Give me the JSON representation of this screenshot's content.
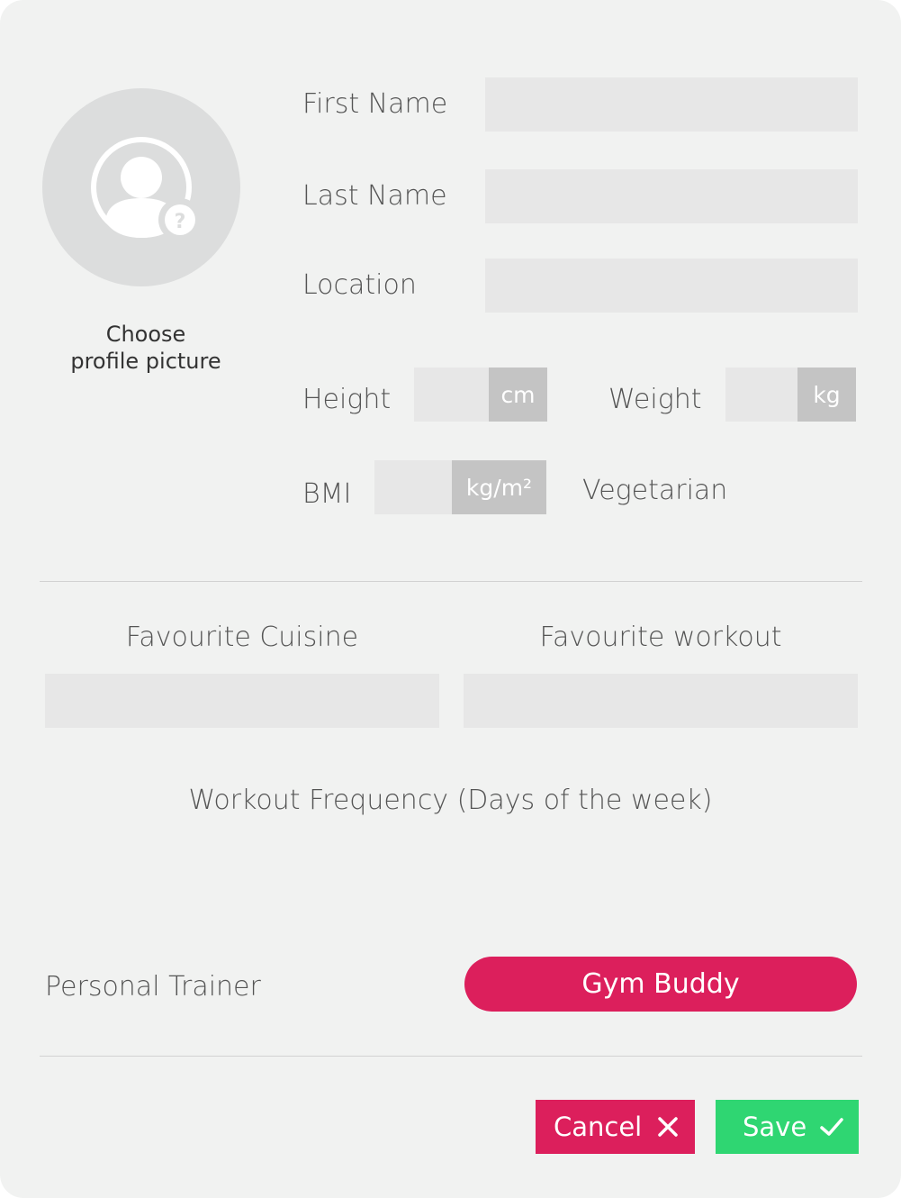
{
  "profile": {
    "choose_line1": "Choose",
    "choose_line2": "profile picture",
    "avatar_icon": "user-question-icon"
  },
  "fields": {
    "first_name": {
      "label": "First Name",
      "value": ""
    },
    "last_name": {
      "label": "Last Name",
      "value": ""
    },
    "location": {
      "label": "Location",
      "value": ""
    },
    "height": {
      "label": "Height",
      "unit": "cm",
      "value": ""
    },
    "weight": {
      "label": "Weight",
      "unit": "kg",
      "value": ""
    },
    "bmi": {
      "label": "BMI",
      "unit": "kg/m²",
      "value": ""
    },
    "vegetarian": {
      "label": "Vegetarian"
    }
  },
  "favourites": {
    "cuisine_label": "Favourite Cuisine",
    "cuisine_value": "",
    "workout_label": "Favourite workout",
    "workout_value": ""
  },
  "frequency": {
    "label": "Workout Frequency (Days of the week)"
  },
  "trainer": {
    "label": "Personal Trainer",
    "gym_buddy": "Gym Buddy"
  },
  "actions": {
    "cancel": "Cancel",
    "save": "Save"
  },
  "colors": {
    "accent_pink": "#dc1f5c",
    "save_green": "#2fd672",
    "field_bg": "#e7e7e7",
    "unit_bg": "#c4c4c4",
    "panel_bg": "#f1f2f1"
  }
}
